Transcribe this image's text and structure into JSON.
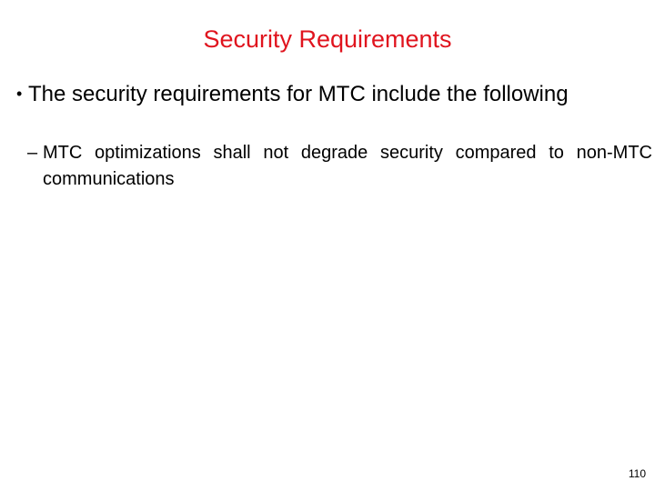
{
  "slide": {
    "title": "Security Requirements",
    "title_color": "#e0141e",
    "bullets": [
      {
        "level": 1,
        "marker": "•",
        "text": "The security requirements for MTC include the following"
      },
      {
        "level": 2,
        "marker": "–",
        "text": "MTC optimizations shall not degrade security compared to non-MTC communications"
      }
    ],
    "page_number": "110"
  }
}
